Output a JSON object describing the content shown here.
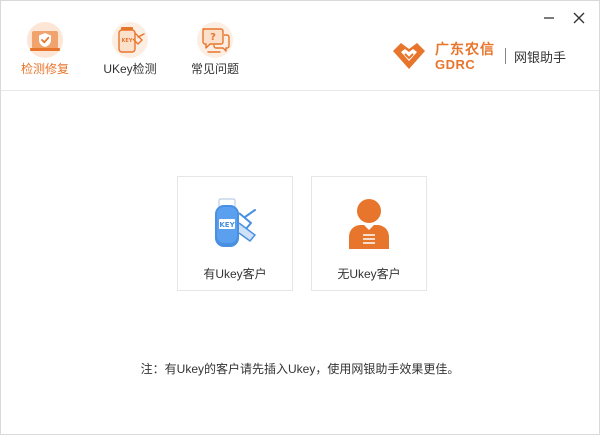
{
  "window": {
    "controls": {
      "minimize_icon": "minimize-icon",
      "close_icon": "close-icon"
    }
  },
  "tabs": [
    {
      "label": "检测修复",
      "icon": "shield-check-icon",
      "active": true
    },
    {
      "label": "UKey检测",
      "icon": "ukey-icon",
      "active": false
    },
    {
      "label": "常见问题",
      "icon": "help-chat-icon",
      "active": false
    }
  ],
  "brand": {
    "name_cn": "广东农信",
    "name_en": "GDRC",
    "product": "网银助手",
    "color": "#e8752c"
  },
  "cards": [
    {
      "label": "有Ukey客户",
      "icon": "ukey-key-icon"
    },
    {
      "label": "无Ukey客户",
      "icon": "person-icon"
    }
  ],
  "note": "注：有Ukey的客户请先插入Ukey，使用网银助手效果更佳。",
  "colors": {
    "accent": "#e8752c",
    "blue": "#4a90e2",
    "border": "#e6e6e6"
  }
}
